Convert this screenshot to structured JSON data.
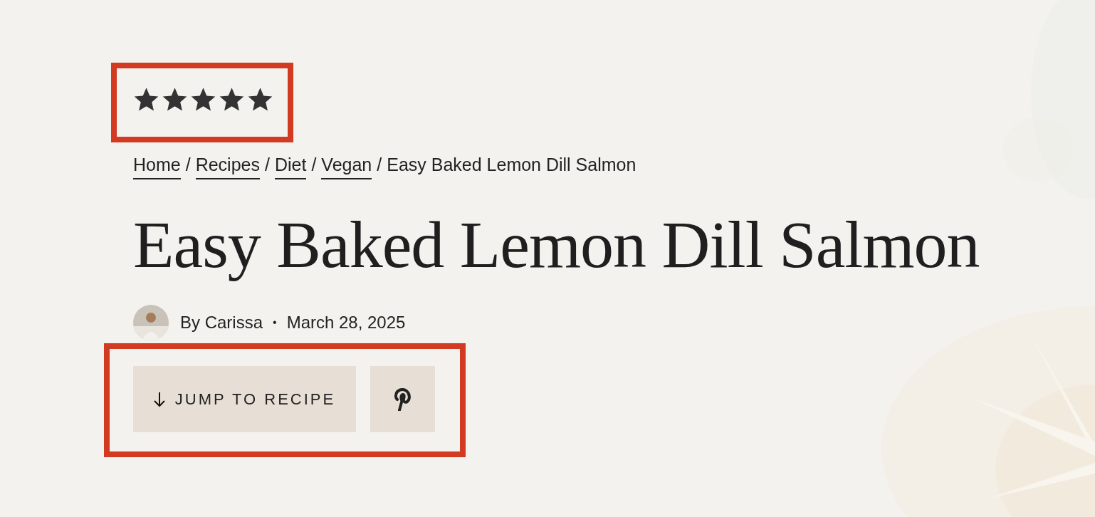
{
  "rating": {
    "stars": 5
  },
  "breadcrumbs": [
    {
      "label": "Home",
      "kind": "link"
    },
    {
      "label": "Recipes",
      "kind": "link"
    },
    {
      "label": "Diet",
      "kind": "link"
    },
    {
      "label": "Vegan",
      "kind": "link"
    },
    {
      "label": "Easy Baked Lemon Dill Salmon",
      "kind": "current"
    }
  ],
  "breadcrumb_separator": "/",
  "title": "Easy Baked Lemon Dill Salmon",
  "meta": {
    "author": "By Carissa",
    "separator": "•",
    "date": "March 28, 2025"
  },
  "actions": [
    {
      "label": "JUMP TO RECIPE",
      "kind": "jump"
    },
    {
      "kind": "pinterest"
    }
  ]
}
